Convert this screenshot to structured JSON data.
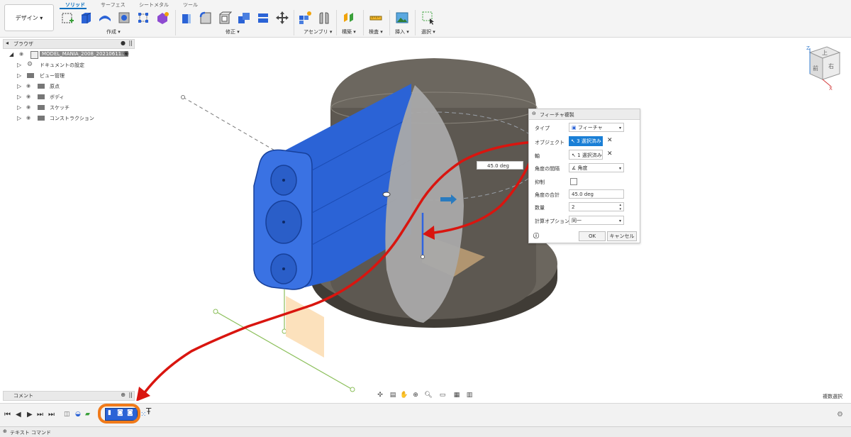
{
  "workspace": {
    "label": "デザイン ▾"
  },
  "ribbon": {
    "tabs": [
      {
        "label": "ソリッド",
        "active": true
      },
      {
        "label": "サーフェス",
        "active": false
      },
      {
        "label": "シートメタル",
        "active": false
      },
      {
        "label": "ツール",
        "active": false
      }
    ],
    "groups": [
      "作成 ▾",
      "修正 ▾",
      "アセンブリ ▾",
      "構築 ▾",
      "検査 ▾",
      "挿入 ▾",
      "選択 ▾"
    ]
  },
  "browser": {
    "title": "ブラウザ",
    "root": "MODEL_MANIA_2008_20210611...",
    "items": [
      "ドキュメントの設定",
      "ビュー管理",
      "原点",
      "ボディ",
      "スケッチ",
      "コンストラクション"
    ]
  },
  "comments": {
    "title": "コメント"
  },
  "dialog": {
    "title": "フィーチャ複製",
    "type_label": "タイプ",
    "type_value": "フィーチャ",
    "objects_label": "オブジェクト",
    "objects_value": "3 選択済み",
    "axis_label": "軸",
    "axis_value": "1 選択済み",
    "angle_spacing_label": "角度の間隔",
    "angle_spacing_value": "角度",
    "suppress_label": "抑制",
    "total_angle_label": "角度の合計",
    "total_angle_value": "45.0 deg",
    "quantity_label": "数量",
    "quantity_value": "2",
    "compute_label": "計算オプション",
    "compute_value": "同一",
    "ok_label": "OK",
    "cancel_label": "キャンセル"
  },
  "viewport": {
    "angle_input": "45.0 deg",
    "status_right": "複数選択"
  },
  "viewcube": {
    "top": "上",
    "front": "前",
    "right": "右",
    "axis_z": "Z",
    "axis_x": "X"
  },
  "text_command": {
    "label": "テキスト コマンド"
  },
  "colors": {
    "accent": "#0a6fbf",
    "body_blue": "#2b63d6",
    "arrow_red": "#d9150f",
    "highlight_orange": "#f07a1a"
  }
}
